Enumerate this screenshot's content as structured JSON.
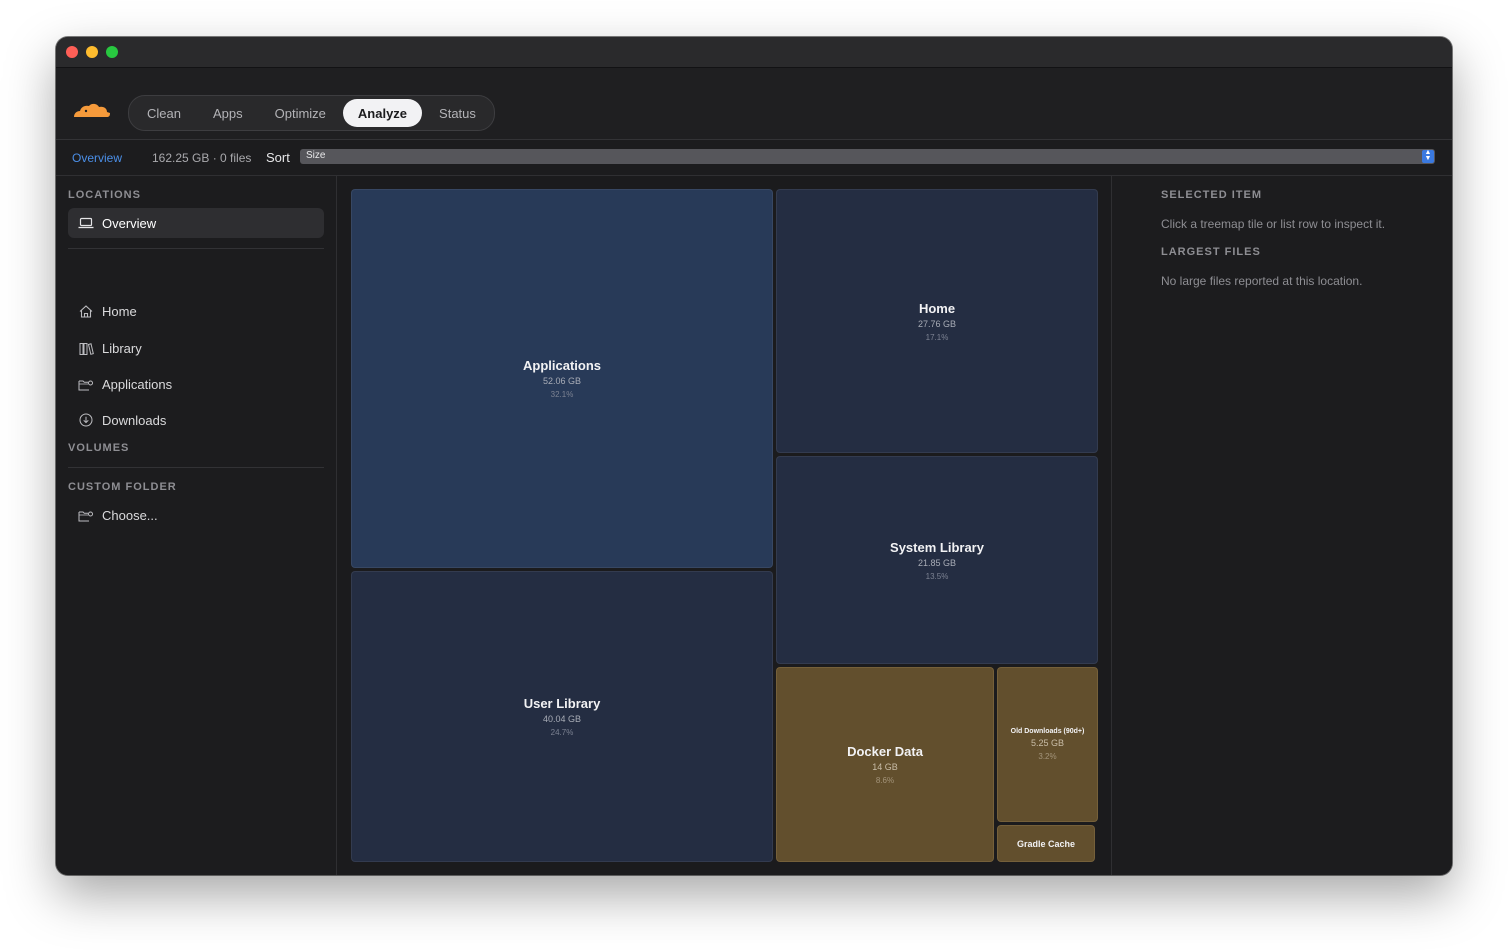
{
  "app": {
    "accent_color": "#4b8fe8",
    "logo_icon": "cloud-logo-icon",
    "logo_color": "#f59a3b"
  },
  "tabs": [
    {
      "label": "Clean",
      "active": false
    },
    {
      "label": "Apps",
      "active": false
    },
    {
      "label": "Optimize",
      "active": false
    },
    {
      "label": "Analyze",
      "active": true
    },
    {
      "label": "Status",
      "active": false
    }
  ],
  "subbar": {
    "breadcrumb": "Overview",
    "stats": "162.25 GB · 0 files",
    "sort_label": "Sort",
    "sort_value": "Size"
  },
  "sidebar": {
    "locations_title": "LOCATIONS",
    "overview": {
      "label": "Overview",
      "icon": "laptop-icon"
    },
    "items": [
      {
        "label": "Home",
        "icon": "house-icon"
      },
      {
        "label": "Library",
        "icon": "books-icon"
      },
      {
        "label": "Applications",
        "icon": "folder-gear-icon"
      },
      {
        "label": "Downloads",
        "icon": "download-circle-icon"
      }
    ],
    "volumes_title": "VOLUMES",
    "custom_title": "CUSTOM FOLDER",
    "choose": {
      "label": "Choose...",
      "icon": "folder-gear-icon"
    }
  },
  "treemap": {
    "tiles": [
      {
        "name": "Applications",
        "size": "52.06 GB",
        "percent": "32.1%",
        "color": "#283a58"
      },
      {
        "name": "User Library",
        "size": "40.04 GB",
        "percent": "24.7%",
        "color": "#242d42"
      },
      {
        "name": "Home",
        "size": "27.76 GB",
        "percent": "17.1%",
        "color": "#242d42"
      },
      {
        "name": "System Library",
        "size": "21.85 GB",
        "percent": "13.5%",
        "color": "#242d42"
      },
      {
        "name": "Docker Data",
        "size": "14 GB",
        "percent": "8.6%",
        "color": "#624f2d"
      },
      {
        "name": "Old Downloads (90d+)",
        "size": "5.25 GB",
        "percent": "3.2%",
        "color": "#624f2d"
      },
      {
        "name": "Gradle Cache",
        "color": "#624f2d"
      }
    ]
  },
  "inspector": {
    "selected_title": "SELECTED ITEM",
    "selected_hint": "Click a treemap tile or list row to inspect it.",
    "largest_title": "LARGEST FILES",
    "largest_empty": "No large files reported at this location."
  }
}
